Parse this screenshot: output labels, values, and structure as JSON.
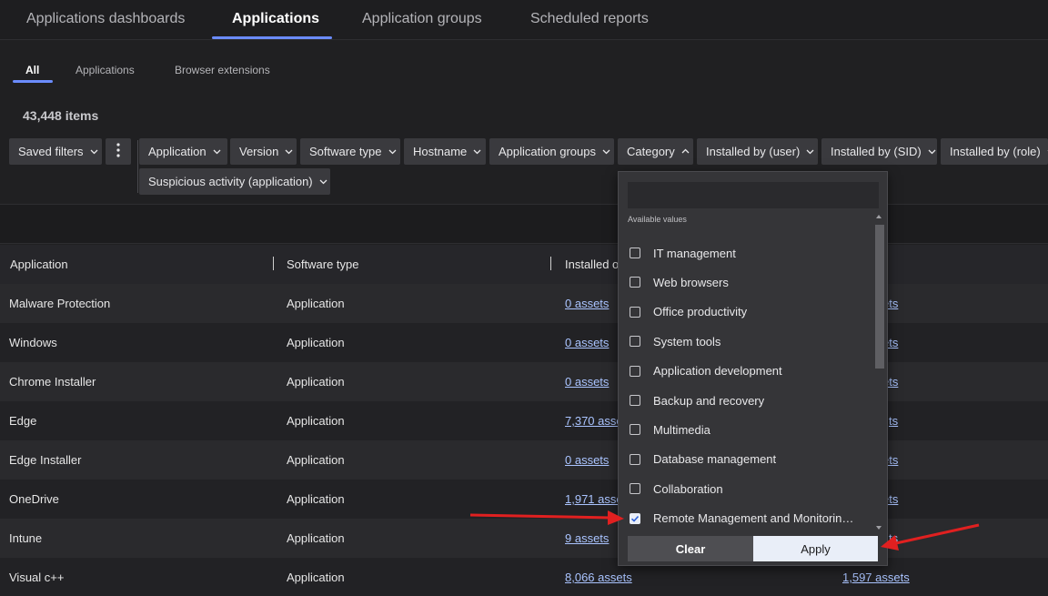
{
  "top_tabs": [
    {
      "label": "Applications dashboards"
    },
    {
      "label": "Applications"
    },
    {
      "label": "Application groups"
    },
    {
      "label": "Scheduled reports"
    }
  ],
  "sub_tabs": [
    {
      "label": "All"
    },
    {
      "label": "Applications"
    },
    {
      "label": "Browser extensions"
    }
  ],
  "item_count": "43,448 items",
  "filters": {
    "saved_filters": "Saved filters",
    "chips": [
      "Application",
      "Version",
      "Software type",
      "Hostname",
      "Application groups",
      "Category",
      "Installed by (user)",
      "Installed by (SID)",
      "Installed by (role)",
      "Suspicious activity (application)"
    ]
  },
  "table": {
    "columns": [
      "Application",
      "Software type",
      "Installed o"
    ],
    "rows": [
      {
        "application": "Malware Protection",
        "software_type": "Application",
        "installed": "0 assets",
        "right": "ets"
      },
      {
        "application": "Windows",
        "software_type": "Application",
        "installed": "0 assets",
        "right": "ets"
      },
      {
        "application": "Chrome Installer",
        "software_type": "Application",
        "installed": "0 assets",
        "right": "ets"
      },
      {
        "application": "Edge",
        "software_type": "Application",
        "installed": "7,370 asse",
        "right": "ts"
      },
      {
        "application": "Edge Installer",
        "software_type": "Application",
        "installed": "0 assets",
        "right": "ets"
      },
      {
        "application": "OneDrive",
        "software_type": "Application",
        "installed": "1,971 asset",
        "right": "ets"
      },
      {
        "application": "Intune",
        "software_type": "Application",
        "installed": "9 assets",
        "right": "ts"
      },
      {
        "application": "Visual c++",
        "software_type": "Application",
        "installed": "8,066 assets",
        "right": "1,597 assets"
      }
    ]
  },
  "category_dropdown": {
    "search_value": "",
    "caption": "Available values",
    "options": [
      {
        "label": "IT management",
        "checked": false
      },
      {
        "label": "Web browsers",
        "checked": false
      },
      {
        "label": "Office productivity",
        "checked": false
      },
      {
        "label": "System tools",
        "checked": false
      },
      {
        "label": "Application development",
        "checked": false
      },
      {
        "label": "Backup and recovery",
        "checked": false
      },
      {
        "label": "Multimedia",
        "checked": false
      },
      {
        "label": "Database management",
        "checked": false
      },
      {
        "label": "Collaboration",
        "checked": false
      },
      {
        "label": "Remote Management and Monitoring …",
        "checked": true
      }
    ],
    "clear_label": "Clear",
    "apply_label": "Apply"
  },
  "colors": {
    "accent": "#6b8cff",
    "link": "#aac4ff",
    "annotation_arrow": "#e02020"
  }
}
